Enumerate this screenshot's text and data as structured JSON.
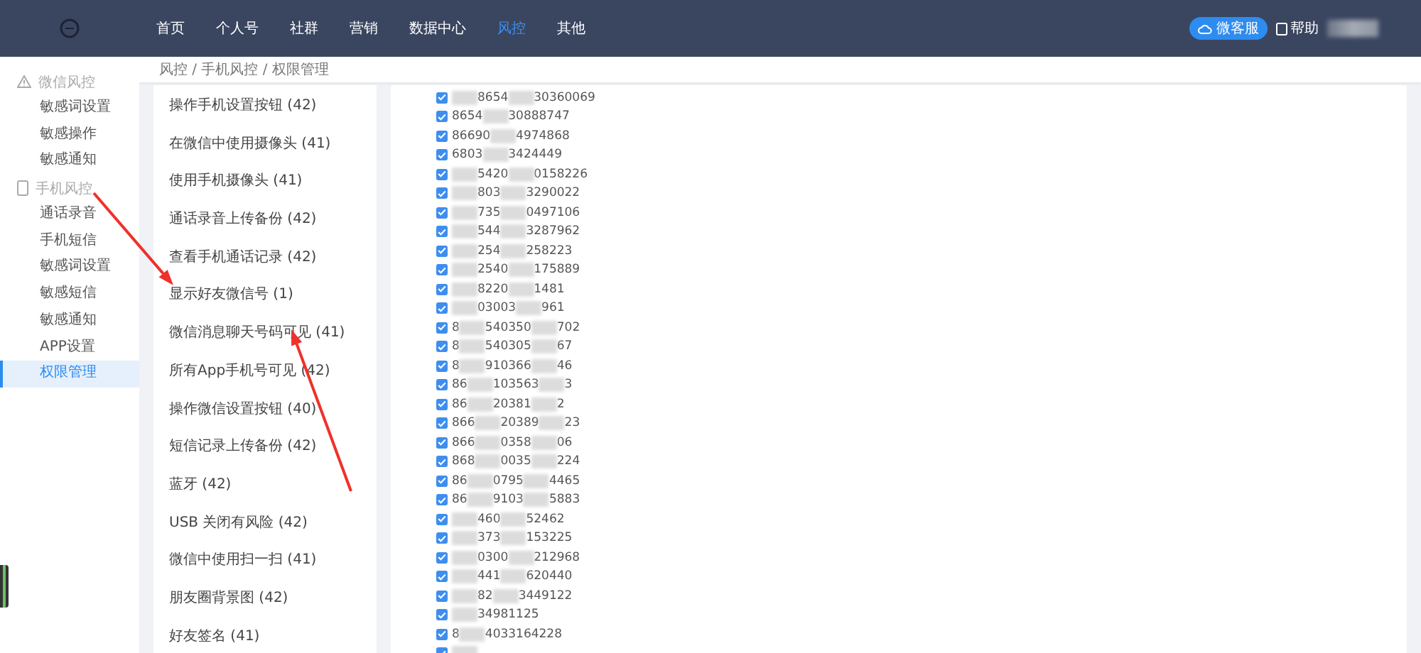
{
  "header": {
    "nav": [
      {
        "label": "首页",
        "selected": false
      },
      {
        "label": "个人号",
        "selected": false
      },
      {
        "label": "社群",
        "selected": false
      },
      {
        "label": "营销",
        "selected": false
      },
      {
        "label": "数据中心",
        "selected": false
      },
      {
        "label": "风控",
        "selected": true
      },
      {
        "label": "其他",
        "selected": false
      }
    ],
    "service_button": "微客服",
    "help": "帮助"
  },
  "sidebar": {
    "groups": [
      {
        "title": "微信风控",
        "kind": "warning",
        "items": [
          {
            "label": "敏感词设置",
            "selected": false
          },
          {
            "label": "敏感操作",
            "selected": false
          },
          {
            "label": "敏感通知",
            "selected": false
          }
        ]
      },
      {
        "title": "手机风控",
        "kind": "phone",
        "items": [
          {
            "label": "通话录音",
            "selected": false
          },
          {
            "label": "手机短信",
            "selected": false
          },
          {
            "label": "敏感词设置",
            "selected": false
          },
          {
            "label": "敏感短信",
            "selected": false
          },
          {
            "label": "敏感通知",
            "selected": false
          },
          {
            "label": "APP设置",
            "selected": false
          },
          {
            "label": "权限管理",
            "selected": true
          }
        ]
      }
    ]
  },
  "breadcrumb": "风控 / 手机风控 / 权限管理",
  "permissions": [
    "操作手机设置按钮 (42)",
    "在微信中使用摄像头 (41)",
    "使用手机摄像头 (41)",
    "通话录音上传备份 (42)",
    "查看手机通话记录 (42)",
    "显示好友微信号 (1)",
    "微信消息聊天号码可见 (41)",
    "所有App手机号可见 (42)",
    "操作微信设置按钮 (40)",
    "短信记录上传备份 (42)",
    "蓝牙 (42)",
    "USB 关闭有风险 (42)",
    "微信中使用扫一扫 (41)",
    "朋友圈背景图 (42)",
    "好友签名 (41)"
  ],
  "devices": [
    {
      "checked": true,
      "parts": [
        {
          "kind": "blur"
        },
        {
          "kind": "text",
          "text": "8654"
        },
        {
          "kind": "blur"
        },
        {
          "kind": "text",
          "text": "30360069"
        }
      ]
    },
    {
      "checked": true,
      "parts": [
        {
          "kind": "text",
          "text": "8654"
        },
        {
          "kind": "blur"
        },
        {
          "kind": "text",
          "text": "30888747"
        }
      ]
    },
    {
      "checked": true,
      "parts": [
        {
          "kind": "text",
          "text": "86690"
        },
        {
          "kind": "blur"
        },
        {
          "kind": "text",
          "text": "4974868"
        }
      ]
    },
    {
      "checked": true,
      "parts": [
        {
          "kind": "text",
          "text": "6803"
        },
        {
          "kind": "blur"
        },
        {
          "kind": "text",
          "text": "3424449"
        }
      ]
    },
    {
      "checked": true,
      "parts": [
        {
          "kind": "blur"
        },
        {
          "kind": "text",
          "text": "5420"
        },
        {
          "kind": "blur"
        },
        {
          "kind": "text",
          "text": "0158226"
        }
      ]
    },
    {
      "checked": true,
      "parts": [
        {
          "kind": "blur"
        },
        {
          "kind": "text",
          "text": "803"
        },
        {
          "kind": "blur"
        },
        {
          "kind": "text",
          "text": "3290022"
        }
      ]
    },
    {
      "checked": true,
      "parts": [
        {
          "kind": "blur"
        },
        {
          "kind": "text",
          "text": "735"
        },
        {
          "kind": "blur"
        },
        {
          "kind": "text",
          "text": "0497106"
        }
      ]
    },
    {
      "checked": true,
      "parts": [
        {
          "kind": "blur"
        },
        {
          "kind": "text",
          "text": "544"
        },
        {
          "kind": "blur"
        },
        {
          "kind": "text",
          "text": "3287962"
        }
      ]
    },
    {
      "checked": true,
      "parts": [
        {
          "kind": "blur"
        },
        {
          "kind": "text",
          "text": "254"
        },
        {
          "kind": "blur"
        },
        {
          "kind": "text",
          "text": "258223"
        }
      ]
    },
    {
      "checked": true,
      "parts": [
        {
          "kind": "blur"
        },
        {
          "kind": "text",
          "text": "2540"
        },
        {
          "kind": "blur"
        },
        {
          "kind": "text",
          "text": "175889"
        }
      ]
    },
    {
      "checked": true,
      "parts": [
        {
          "kind": "blur"
        },
        {
          "kind": "text",
          "text": "8220"
        },
        {
          "kind": "blur"
        },
        {
          "kind": "text",
          "text": "1481"
        }
      ]
    },
    {
      "checked": true,
      "parts": [
        {
          "kind": "blur"
        },
        {
          "kind": "text",
          "text": "03003"
        },
        {
          "kind": "blur"
        },
        {
          "kind": "text",
          "text": "961"
        }
      ]
    },
    {
      "checked": true,
      "parts": [
        {
          "kind": "text",
          "text": "8"
        },
        {
          "kind": "blur"
        },
        {
          "kind": "text",
          "text": "540350"
        },
        {
          "kind": "blur"
        },
        {
          "kind": "text",
          "text": "702"
        }
      ]
    },
    {
      "checked": true,
      "parts": [
        {
          "kind": "text",
          "text": "8"
        },
        {
          "kind": "blur"
        },
        {
          "kind": "text",
          "text": "540305"
        },
        {
          "kind": "blur"
        },
        {
          "kind": "text",
          "text": "67"
        }
      ]
    },
    {
      "checked": true,
      "parts": [
        {
          "kind": "text",
          "text": "8"
        },
        {
          "kind": "blur"
        },
        {
          "kind": "text",
          "text": "910366"
        },
        {
          "kind": "blur"
        },
        {
          "kind": "text",
          "text": "46"
        }
      ]
    },
    {
      "checked": true,
      "parts": [
        {
          "kind": "text",
          "text": "86"
        },
        {
          "kind": "blur"
        },
        {
          "kind": "text",
          "text": "103563"
        },
        {
          "kind": "blur"
        },
        {
          "kind": "text",
          "text": "3"
        }
      ]
    },
    {
      "checked": true,
      "parts": [
        {
          "kind": "text",
          "text": "86"
        },
        {
          "kind": "blur"
        },
        {
          "kind": "text",
          "text": "20381"
        },
        {
          "kind": "blur"
        },
        {
          "kind": "text",
          "text": "2"
        }
      ]
    },
    {
      "checked": true,
      "parts": [
        {
          "kind": "text",
          "text": "866"
        },
        {
          "kind": "blur"
        },
        {
          "kind": "text",
          "text": "20389"
        },
        {
          "kind": "blur"
        },
        {
          "kind": "text",
          "text": "23"
        }
      ]
    },
    {
      "checked": true,
      "parts": [
        {
          "kind": "text",
          "text": "866"
        },
        {
          "kind": "blur"
        },
        {
          "kind": "text",
          "text": "0358"
        },
        {
          "kind": "blur"
        },
        {
          "kind": "text",
          "text": "06"
        }
      ]
    },
    {
      "checked": true,
      "parts": [
        {
          "kind": "text",
          "text": "868"
        },
        {
          "kind": "blur"
        },
        {
          "kind": "text",
          "text": "0035"
        },
        {
          "kind": "blur"
        },
        {
          "kind": "text",
          "text": "224"
        }
      ]
    },
    {
      "checked": true,
      "parts": [
        {
          "kind": "text",
          "text": "86"
        },
        {
          "kind": "blur"
        },
        {
          "kind": "text",
          "text": "0795"
        },
        {
          "kind": "blur"
        },
        {
          "kind": "text",
          "text": "4465"
        }
      ]
    },
    {
      "checked": true,
      "parts": [
        {
          "kind": "text",
          "text": "86"
        },
        {
          "kind": "blur"
        },
        {
          "kind": "text",
          "text": "9103"
        },
        {
          "kind": "blur"
        },
        {
          "kind": "text",
          "text": "5883"
        }
      ]
    },
    {
      "checked": true,
      "parts": [
        {
          "kind": "blur"
        },
        {
          "kind": "text",
          "text": "460"
        },
        {
          "kind": "blur"
        },
        {
          "kind": "text",
          "text": "52462"
        }
      ]
    },
    {
      "checked": true,
      "parts": [
        {
          "kind": "blur"
        },
        {
          "kind": "text",
          "text": "373"
        },
        {
          "kind": "blur"
        },
        {
          "kind": "text",
          "text": "153225"
        }
      ]
    },
    {
      "checked": true,
      "parts": [
        {
          "kind": "blur"
        },
        {
          "kind": "text",
          "text": "0300"
        },
        {
          "kind": "blur"
        },
        {
          "kind": "text",
          "text": "212968"
        }
      ]
    },
    {
      "checked": true,
      "parts": [
        {
          "kind": "blur"
        },
        {
          "kind": "text",
          "text": "441"
        },
        {
          "kind": "blur"
        },
        {
          "kind": "text",
          "text": "620440"
        }
      ]
    },
    {
      "checked": true,
      "parts": [
        {
          "kind": "blur"
        },
        {
          "kind": "text",
          "text": "82"
        },
        {
          "kind": "blur"
        },
        {
          "kind": "text",
          "text": "3449122"
        }
      ]
    },
    {
      "checked": true,
      "parts": [
        {
          "kind": "blur"
        },
        {
          "kind": "text",
          "text": "34981125"
        }
      ]
    },
    {
      "checked": true,
      "parts": [
        {
          "kind": "text",
          "text": "8"
        },
        {
          "kind": "blur"
        },
        {
          "kind": "text",
          "text": "4033164228"
        }
      ]
    },
    {
      "checked": true,
      "parts": [
        {
          "kind": "blur"
        }
      ]
    }
  ]
}
